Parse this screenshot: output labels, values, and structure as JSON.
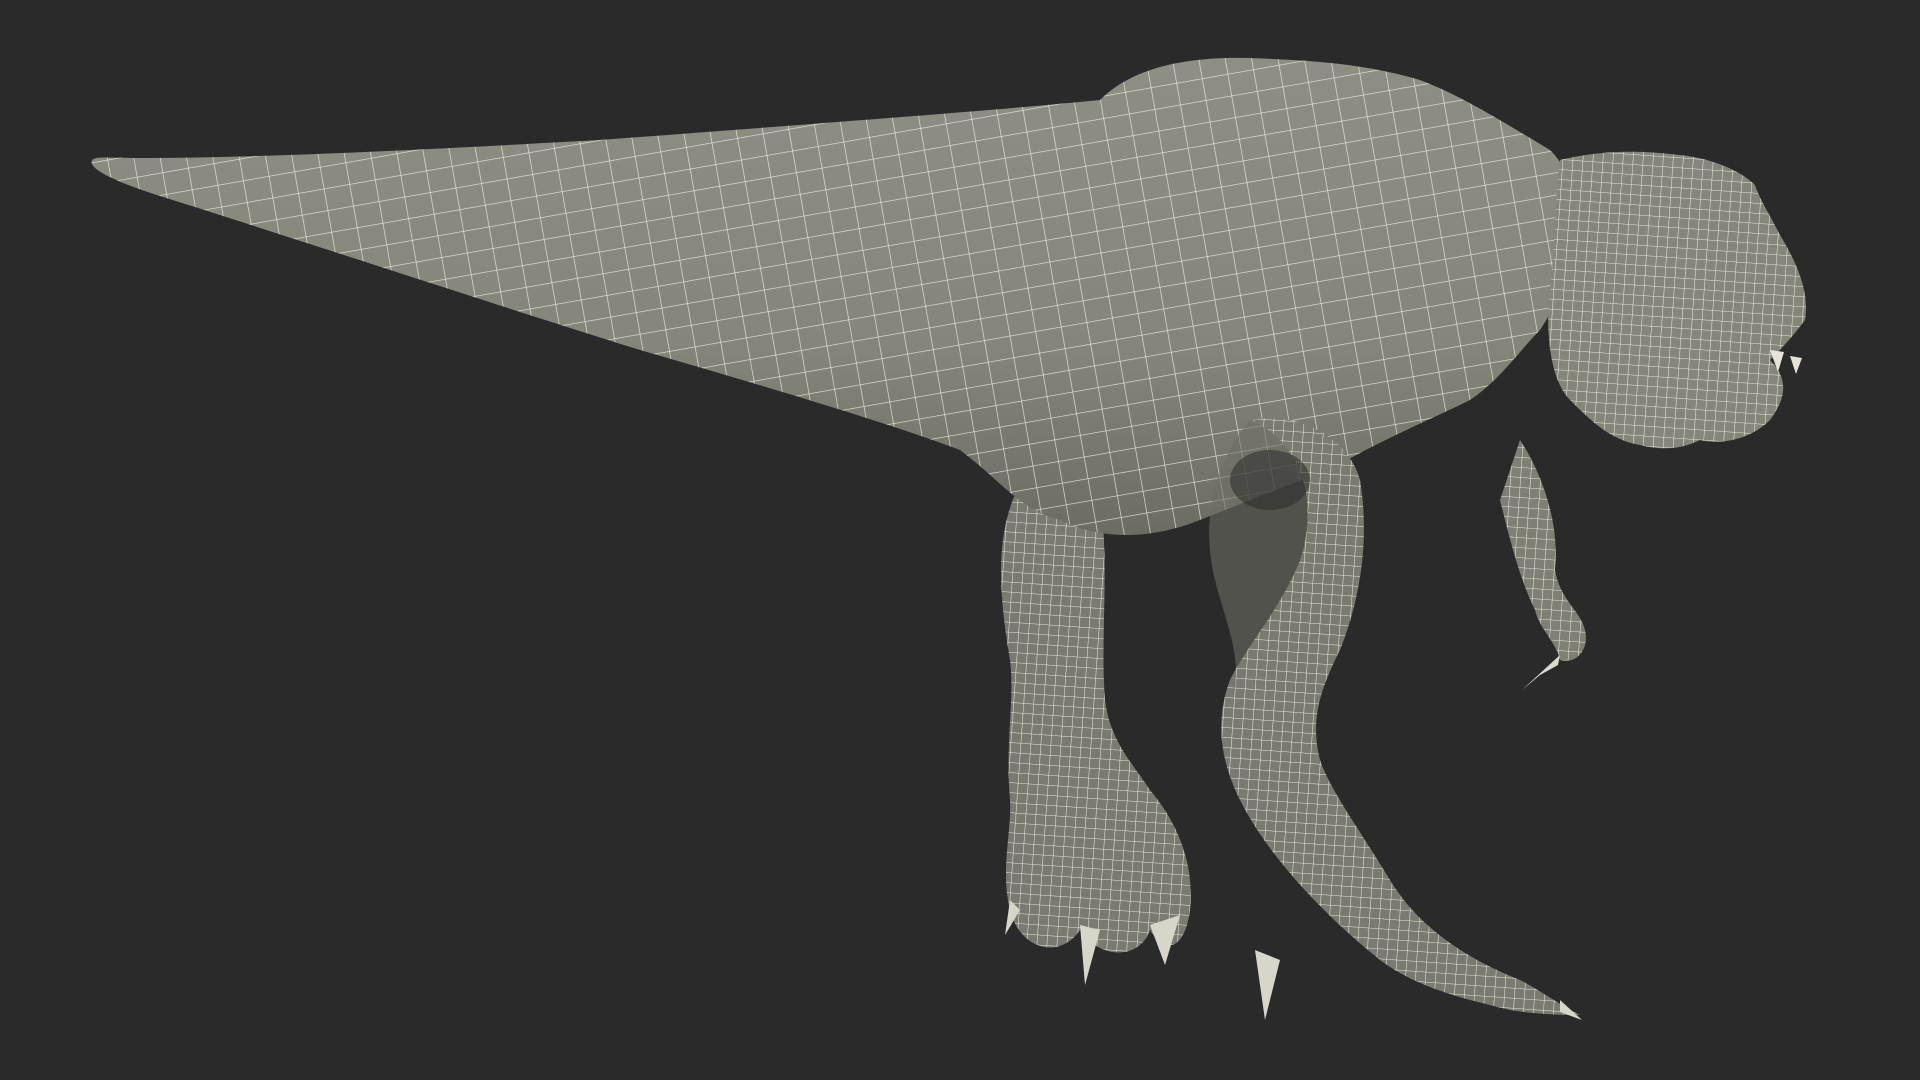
{
  "scene": {
    "subject": "dinosaur-wireframe-render",
    "colors": {
      "background": "#2a2a2a",
      "mesh_fill": "#8a8a7e",
      "mesh_fill_dark": "#6f6f65",
      "mesh_shadow": "#5e5e56",
      "wire": "#f2f1e6"
    }
  }
}
